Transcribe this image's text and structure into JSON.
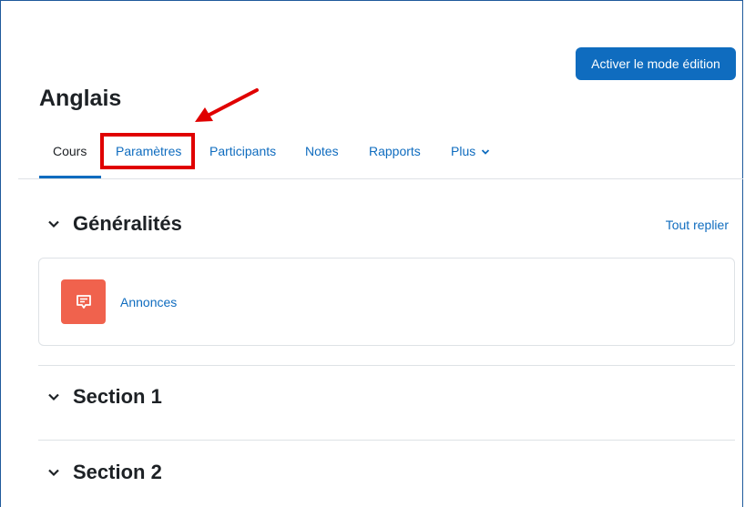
{
  "header": {
    "edit_mode_button": "Activer le mode édition",
    "course_title": "Anglais"
  },
  "tabs": [
    {
      "label": "Cours",
      "active": true
    },
    {
      "label": "Paramètres",
      "active": false,
      "highlighted": true
    },
    {
      "label": "Participants",
      "active": false
    },
    {
      "label": "Notes",
      "active": false
    },
    {
      "label": "Rapports",
      "active": false
    },
    {
      "label": "Plus",
      "active": false,
      "has_dropdown": true
    }
  ],
  "sections": [
    {
      "title": "Généralités",
      "collapse_all_link": "Tout replier",
      "activities": [
        {
          "name": "Annonces",
          "icon": "forum-icon"
        }
      ]
    },
    {
      "title": "Section 1"
    },
    {
      "title": "Section 2"
    }
  ],
  "colors": {
    "primary": "#0f6cbf",
    "annotation": "#e00000",
    "activity_icon_bg": "#f0624d",
    "frame_border": "#1f5a9c"
  }
}
